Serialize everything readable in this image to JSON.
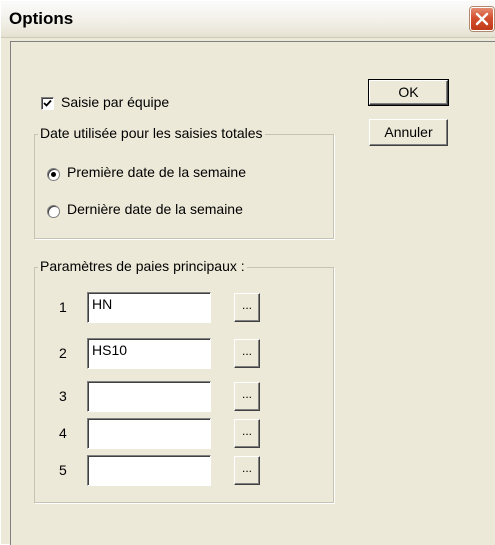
{
  "window": {
    "title": "Options"
  },
  "options": {
    "team_entry": {
      "label": "Saisie par équipe",
      "checked": true
    }
  },
  "date_group": {
    "title": "Date utilisée pour les saisies totales",
    "options": [
      {
        "label": "Première date de la semaine",
        "selected": true
      },
      {
        "label": "Dernière date de la semaine",
        "selected": false
      }
    ]
  },
  "params_group": {
    "title": "Paramètres de paies principaux :",
    "rows": [
      {
        "number": "1",
        "value": "HN",
        "button": "..."
      },
      {
        "number": "2",
        "value": "HS10",
        "button": "..."
      },
      {
        "number": "3",
        "value": "",
        "button": "..."
      },
      {
        "number": "4",
        "value": "",
        "button": "..."
      },
      {
        "number": "5",
        "value": "",
        "button": "..."
      }
    ]
  },
  "buttons": {
    "ok": "OK",
    "cancel": "Annuler"
  },
  "colors": {
    "background": "#ece9d8",
    "close_button": "#d3502f"
  },
  "icons": {
    "close": "close-icon",
    "check": "checkmark-icon"
  }
}
